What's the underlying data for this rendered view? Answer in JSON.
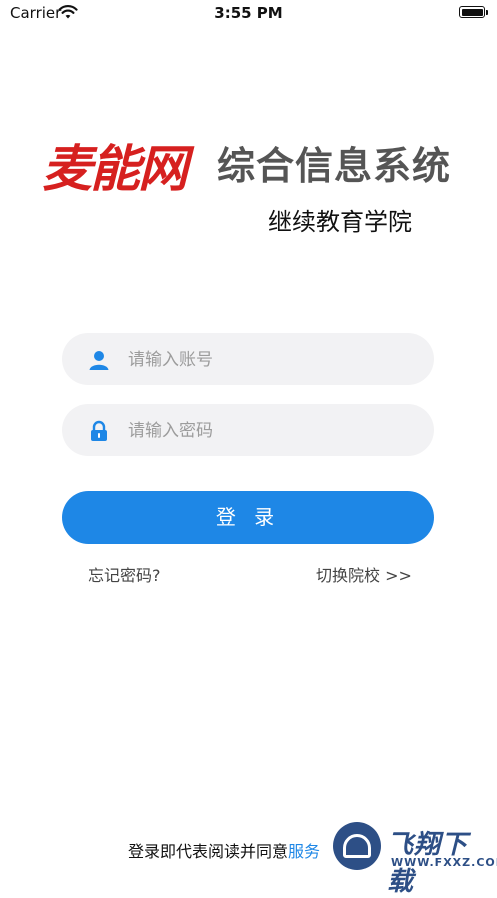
{
  "status_bar": {
    "carrier": "Carrier",
    "time": "3:55 PM"
  },
  "header": {
    "brand": "麦能网",
    "system_name": "综合信息系统",
    "subtitle": "继续教育学院",
    "brand_color": "#d6201f"
  },
  "form": {
    "account_placeholder": "请输入账号",
    "account_value": "",
    "password_placeholder": "请输入密码",
    "password_value": "",
    "user_icon": "user-icon",
    "lock_icon": "lock-icon"
  },
  "actions": {
    "login_label": "登 录",
    "forgot_label": "忘记密码?",
    "switch_label": "切换院校 >>",
    "accent_color": "#1e87e6"
  },
  "footer": {
    "agree_text": "登录即代表阅读并同意",
    "service_link": "服务"
  },
  "watermark": {
    "title": "飞翔下载",
    "url": "WWW.FXXZ.COM"
  }
}
